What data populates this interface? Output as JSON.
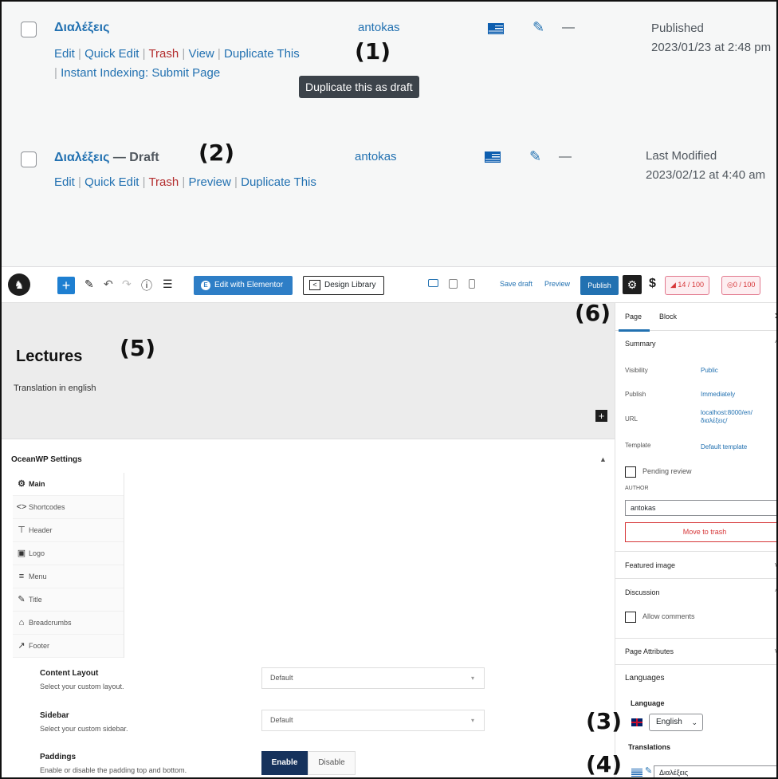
{
  "list": {
    "rows": [
      {
        "title": "Διαλέξεις",
        "actions": [
          "Edit",
          "Quick Edit",
          "Trash",
          "View",
          "Duplicate This",
          "Instant Indexing: Submit Page"
        ],
        "author": "antokas",
        "date_status": "Published",
        "date_value": "2023/01/23 at 2:48 pm"
      },
      {
        "title": "Διαλέξεις",
        "title_suffix": "— Draft",
        "actions": [
          "Edit",
          "Quick Edit",
          "Trash",
          "Preview",
          "Duplicate This"
        ],
        "author": "antokas",
        "date_status": "Last Modified",
        "date_value": "2023/02/12 at 4:40 am"
      }
    ],
    "tooltip": "Duplicate this as draft",
    "separator": "|",
    "dash": "—"
  },
  "annotations": [
    "(1)",
    "(2)",
    "(3)",
    "(4)",
    "(5)",
    "(6)"
  ],
  "toolbar": {
    "elementor_label": "Edit with Elementor",
    "design_library_label": "Design Library",
    "save_draft": "Save draft",
    "preview": "Preview",
    "publish": "Publish",
    "score_seo": "14 / 100",
    "score_readability": "0 / 100"
  },
  "canvas": {
    "title": "Lectures",
    "subtitle": "Translation in english"
  },
  "oceanwp": {
    "title": "OceanWP Settings",
    "nav": [
      {
        "label": "Main",
        "icon": "gear-icon",
        "glyph": "⚙"
      },
      {
        "label": "Shortcodes",
        "icon": "code-icon",
        "glyph": "<>"
      },
      {
        "label": "Header",
        "icon": "pin-icon",
        "glyph": "⊤"
      },
      {
        "label": "Logo",
        "icon": "image-icon",
        "glyph": "▣"
      },
      {
        "label": "Menu",
        "icon": "menu-icon",
        "glyph": "≡"
      },
      {
        "label": "Title",
        "icon": "wrench-icon",
        "glyph": "✎"
      },
      {
        "label": "Breadcrumbs",
        "icon": "home-icon",
        "glyph": "⌂"
      },
      {
        "label": "Footer",
        "icon": "hammer-icon",
        "glyph": "↗"
      }
    ],
    "content_layout": {
      "label": "Content Layout",
      "desc": "Select your custom layout.",
      "value": "Default"
    },
    "sidebar": {
      "label": "Sidebar",
      "desc": "Select your custom sidebar.",
      "value": "Default"
    },
    "paddings": {
      "label": "Paddings",
      "desc": "Enable or disable the padding top and bottom.",
      "enable": "Enable",
      "disable": "Disable"
    }
  },
  "sidebar": {
    "tabs": [
      "Page",
      "Block"
    ],
    "summary": "Summary",
    "visibility_k": "Visibility",
    "visibility_v": "Public",
    "publish_k": "Publish",
    "publish_v": "Immediately",
    "url_k": "URL",
    "url_v1": "localhost:8000/en/",
    "url_v2": "διαλέξεις/",
    "template_k": "Template",
    "template_v": "Default template",
    "pending": "Pending review",
    "author_k": "AUTHOR",
    "author_v": "antokas",
    "trash": "Move to trash",
    "featured": "Featured image",
    "discussion": "Discussion",
    "allow_comments": "Allow comments",
    "page_attributes": "Page Attributes",
    "languages": "Languages",
    "language": "Language",
    "language_value": "English",
    "translations": "Translations",
    "translation_value": "Διαλέξεις"
  },
  "colors": {
    "link": "#2271b1",
    "trash": "#b32d2e",
    "elementor": "#2e7ec6",
    "enable": "#16325c"
  }
}
